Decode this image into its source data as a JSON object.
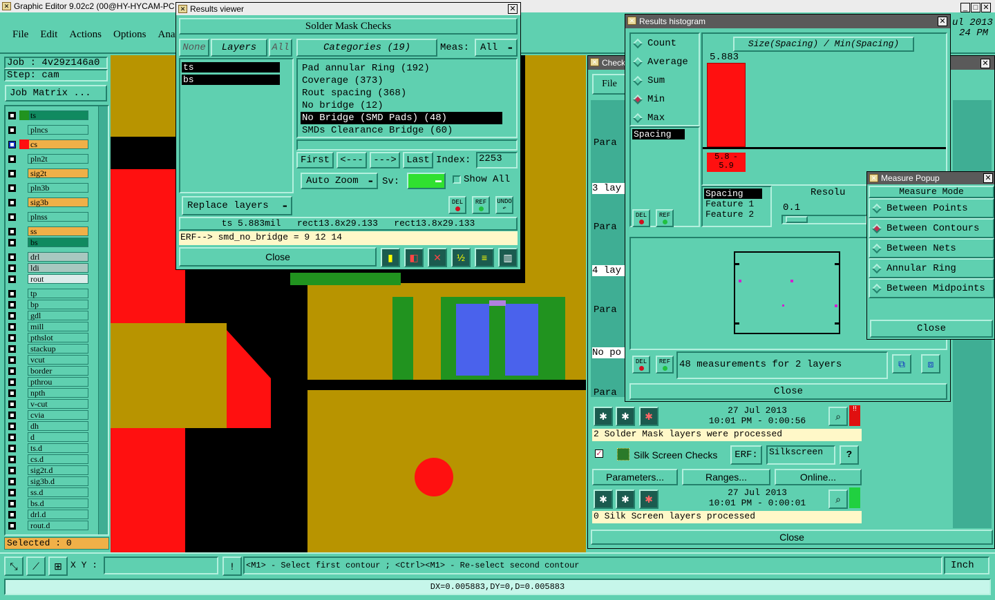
{
  "app": {
    "title": "Graphic Editor 9.02c2 (00@HY-HYCAM-PC",
    "menu": [
      "File",
      "Edit",
      "Actions",
      "Options",
      "Ana"
    ],
    "clock_line1": "ul 2013",
    "clock_line2": "24 PM"
  },
  "job": {
    "job_label": "Job : 4v29z146a0",
    "step_label": "Step: cam",
    "matrix_button": "Job Matrix ..."
  },
  "layers": [
    {
      "name": "ts",
      "color": "#108a60",
      "fill": true
    },
    {
      "name": "plncs",
      "color": "#5fd0b0"
    },
    {
      "name": "cs",
      "color": "#f0b048",
      "fill": true,
      "selected": true
    },
    {
      "name": "pln2t",
      "color": "#5fd0b0"
    },
    {
      "name": "sig2t",
      "color": "#f0b048"
    },
    {
      "name": "pln3b",
      "color": "#5fd0b0"
    },
    {
      "name": "sig3b",
      "color": "#f0b048"
    },
    {
      "name": "plnss",
      "color": "#5fd0b0"
    },
    {
      "name": "ss",
      "color": "#f0b048"
    },
    {
      "name": "bs",
      "color": "#108a60"
    },
    {
      "name": "drl",
      "color": "#a8c8c0"
    },
    {
      "name": "ldi",
      "color": "#a8c8c0"
    },
    {
      "name": "rout",
      "color": "#dcecea"
    },
    {
      "name": "tp",
      "color": "#5fd0b0"
    },
    {
      "name": "bp",
      "color": "#5fd0b0"
    },
    {
      "name": "gdl",
      "color": "#5fd0b0"
    },
    {
      "name": "mill",
      "color": "#5fd0b0"
    },
    {
      "name": "pthslot",
      "color": "#5fd0b0"
    },
    {
      "name": "stackup",
      "color": "#5fd0b0"
    },
    {
      "name": "vcut",
      "color": "#5fd0b0"
    },
    {
      "name": "border",
      "color": "#5fd0b0"
    },
    {
      "name": "pthrou",
      "color": "#5fd0b0"
    },
    {
      "name": "npth",
      "color": "#5fd0b0"
    },
    {
      "name": "v-cut",
      "color": "#5fd0b0"
    },
    {
      "name": "cvia",
      "color": "#5fd0b0"
    },
    {
      "name": "dh",
      "color": "#5fd0b0"
    },
    {
      "name": "d",
      "color": "#5fd0b0"
    },
    {
      "name": "ts.d",
      "color": "#5fd0b0"
    },
    {
      "name": "cs.d",
      "color": "#5fd0b0"
    },
    {
      "name": "sig2t.d",
      "color": "#5fd0b0"
    },
    {
      "name": "sig3b.d",
      "color": "#5fd0b0"
    },
    {
      "name": "ss.d",
      "color": "#5fd0b0"
    },
    {
      "name": "bs.d",
      "color": "#5fd0b0"
    },
    {
      "name": "drl.d",
      "color": "#5fd0b0"
    },
    {
      "name": "rout.d",
      "color": "#5fd0b0"
    }
  ],
  "selected_label": "Selected : 0",
  "status": {
    "xy_label": "X Y :",
    "xy_value": "",
    "hint": "<M1> - Select first contour ; <Ctrl><M1> - Re-select second contour",
    "units": "Inch",
    "measure": "DX=0.005883,DY=0,D=0.005883"
  },
  "results": {
    "title": "Results viewer",
    "heading": "Solder Mask Checks",
    "none_btn": "None",
    "layers_btn": "Layers",
    "all_btn": "All",
    "categories_btn": "Categories (19)",
    "meas_label": "Meas:",
    "meas_value": "All",
    "layer_list": [
      "ts",
      "bs"
    ],
    "categories": [
      "Pad annular Ring (192)",
      "Coverage (373)",
      "Rout spacing (368)",
      "No bridge (12)",
      "No Bridge (SMD Pads) (48)",
      "SMDs Clearance Bridge (60)"
    ],
    "selected_category": 4,
    "first": "First",
    "prev": "<---",
    "next": "--->",
    "last": "Last",
    "index_label": "Index:",
    "index_value": "2253",
    "auto_zoom": "Auto Zoom",
    "sv_label": "Sv:",
    "show_all": "Show All",
    "replace_layers": "Replace layers",
    "del": "DEL",
    "ref": "REF",
    "undo": "UNDO",
    "info": "ts 5.883mil   rect13.8x29.133   rect13.8x29.133",
    "erf": "ERF--> smd_no_bridge = 9 12 14",
    "close": "Close"
  },
  "histogram": {
    "title": "Results histogram",
    "modes": [
      "Count",
      "Average",
      "Sum",
      "Min",
      "Max"
    ],
    "selected_mode": 3,
    "axis_title": "Size(Spacing) / Min(Spacing)",
    "bar_value": "5.883",
    "bar_range": "5.8 - 5.9",
    "list_item": "Spacing",
    "features": [
      "Spacing",
      "Feature 1",
      "Feature 2"
    ],
    "resolution_label": "Resolu",
    "resolution_value": "0.1",
    "measurements": "48 measurements for 2 layers",
    "close": "Close",
    "del": "DEL",
    "ref": "REF"
  },
  "measure": {
    "title": "Measure Popup",
    "heading": "Measure Mode",
    "modes": [
      "Between Points",
      "Between Contours",
      "Between Nets",
      "Annular Ring",
      "Between Midpoints"
    ],
    "selected": 1,
    "close": "Close"
  },
  "checklist": {
    "title": "Check",
    "file_menu": "File",
    "param_label": "Para",
    "rows": [
      "3 lay",
      "4 lay",
      "No po"
    ],
    "date1": "27 Jul 2013",
    "time1": "10:01 PM - 0:00:56",
    "processed1": "2 Solder Mask layers were processed",
    "silk_name": "Silk Screen Checks",
    "erf_label": "ERF:",
    "erf_value": "Silkscreen",
    "help": "?",
    "parameters": "Parameters...",
    "ranges": "Ranges...",
    "online": "Online...",
    "date2": "27 Jul 2013",
    "time2": "10:01 PM - 0:00:01",
    "processed2": "0 Silk Screen layers processed",
    "close": "Close"
  }
}
